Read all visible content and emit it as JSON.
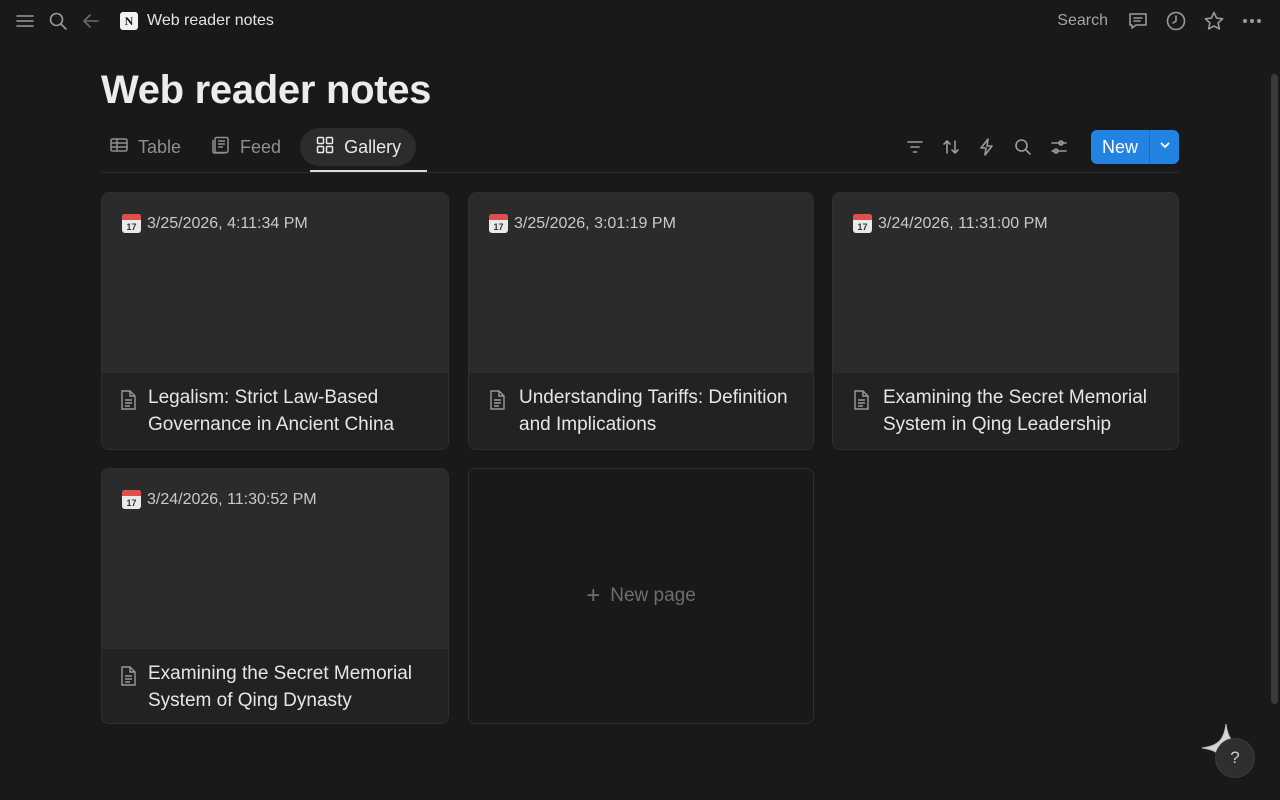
{
  "breadcrumb": {
    "title": "Web reader notes",
    "logo": "N"
  },
  "topbar": {
    "search_label": "Search"
  },
  "page": {
    "title": "Web reader notes"
  },
  "views": [
    {
      "label": "Table",
      "icon": "table-icon"
    },
    {
      "label": "Feed",
      "icon": "feed-icon"
    },
    {
      "label": "Gallery",
      "icon": "gallery-icon",
      "active": true
    }
  ],
  "toolbar": {
    "new_label": "New"
  },
  "cards": [
    {
      "date": "3/25/2026, 4:11:34 PM",
      "title": "Legalism: Strict Law-Based Governance in Ancient China"
    },
    {
      "date": "3/25/2026, 3:01:19 PM",
      "title": "Understanding Tariffs: Definition and Implications"
    },
    {
      "date": "3/24/2026, 11:31:00 PM",
      "title": "Examining the Secret Memorial System in Qing Leadership"
    },
    {
      "date": "3/24/2026, 11:30:52 PM",
      "title": "Examining the Secret Memorial System of Qing Dynasty"
    }
  ],
  "new_page": {
    "label": "New page"
  },
  "calendar_day": "17",
  "help": {
    "label": "?"
  },
  "colors": {
    "accent": "#2383e2",
    "background": "#191919",
    "card_cover": "#2b2b2b"
  }
}
